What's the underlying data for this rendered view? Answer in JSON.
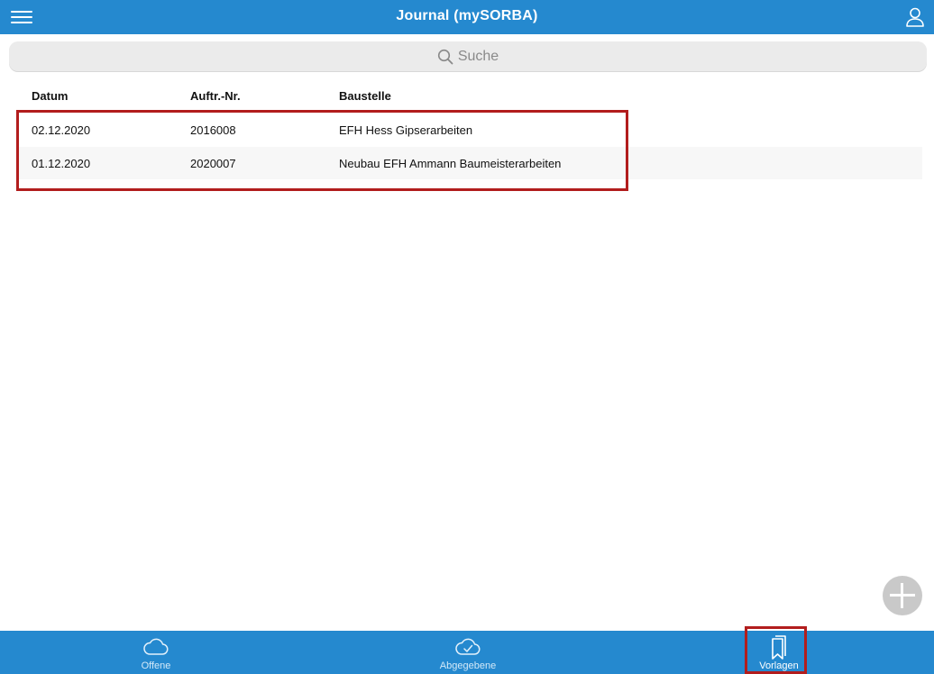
{
  "header": {
    "title": "Journal (mySORBA)",
    "menu_icon": "hamburger-menu-icon",
    "user_icon": "user-icon"
  },
  "search": {
    "placeholder": "Suche",
    "icon": "search-icon"
  },
  "table": {
    "columns": [
      "Datum",
      "Auftr.-Nr.",
      "Baustelle"
    ],
    "rows": [
      {
        "datum": "02.12.2020",
        "auftrag": "2016008",
        "baustelle": "EFH Hess Gipserarbeiten"
      },
      {
        "datum": "01.12.2020",
        "auftrag": "2020007",
        "baustelle": "Neubau EFH Ammann Baumeisterarbeiten"
      }
    ]
  },
  "fab": {
    "icon": "plus-icon"
  },
  "tabbar": {
    "tabs": [
      {
        "label": "Offene",
        "icon": "cloud-icon",
        "active": false
      },
      {
        "label": "Abgegebene",
        "icon": "cloud-check-icon",
        "active": false
      },
      {
        "label": "Vorlagen",
        "icon": "bookmarks-icon",
        "active": true
      }
    ]
  },
  "colors": {
    "primary": "#2589cf",
    "highlight": "#b21d1d",
    "search_bg": "#ebebeb",
    "fab": "#c9c9c9"
  }
}
